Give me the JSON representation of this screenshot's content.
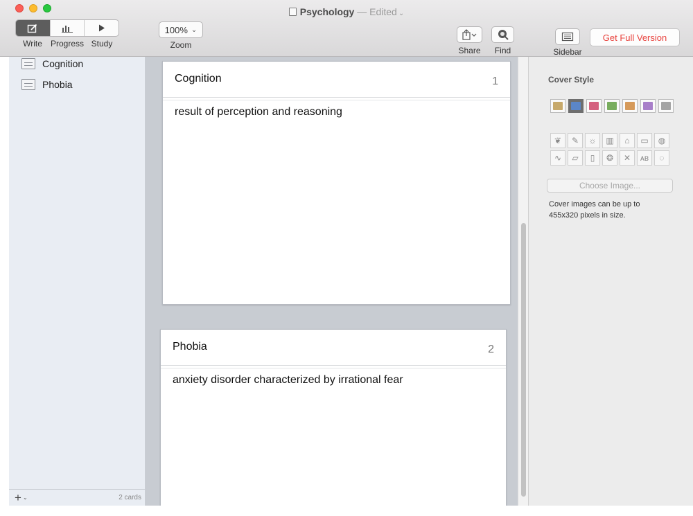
{
  "window": {
    "title": "Psychology",
    "edited_label": "— Edited",
    "edited_caret": "⌄"
  },
  "toolbar": {
    "modes": [
      {
        "label": "Write",
        "icon": "compose-icon",
        "active": true
      },
      {
        "label": "Progress",
        "icon": "bar-chart-icon",
        "active": false
      },
      {
        "label": "Study",
        "icon": "play-icon",
        "active": false
      }
    ],
    "zoom_value": "100%",
    "zoom_caret": "⌄",
    "zoom_label": "Zoom",
    "share_label": "Share",
    "find_label": "Find",
    "sidebar_label": "Sidebar",
    "get_full_label": "Get Full Version"
  },
  "sidebar": {
    "items": [
      {
        "label": "Cognition",
        "icon": "card-icon"
      },
      {
        "label": "Phobia",
        "icon": "card-icon"
      }
    ],
    "add_label": "+",
    "add_caret": "⌄",
    "count_label": "2 cards"
  },
  "cards": [
    {
      "title": "Cognition",
      "number": "1",
      "body": "result of perception and reasoning"
    },
    {
      "title": "Phobia",
      "number": "2",
      "body": "anxiety disorder characterized by irrational fear"
    }
  ],
  "inspector": {
    "title": "Cover Style",
    "swatches": [
      {
        "color": "#c7a96b",
        "selected": false
      },
      {
        "color": "#5b86c8",
        "selected": true
      },
      {
        "color": "#d4607e",
        "selected": false
      },
      {
        "color": "#78ad5e",
        "selected": false
      },
      {
        "color": "#d69a5a",
        "selected": false
      },
      {
        "color": "#a87fc9",
        "selected": false
      },
      {
        "color": "#a3a3a3",
        "selected": false
      }
    ],
    "icons": [
      "leaf-icon",
      "brush-icon",
      "lightbulb-icon",
      "chart-icon",
      "bank-icon",
      "easel-icon",
      "globe-icon",
      "pulse-icon",
      "laptop-icon",
      "book-icon",
      "brain-icon",
      "tools-icon",
      "abc-icon",
      "speech-bubble-icon"
    ],
    "choose_label": "Choose Image...",
    "note": "Cover images can be up to 455x320 pixels in size."
  }
}
